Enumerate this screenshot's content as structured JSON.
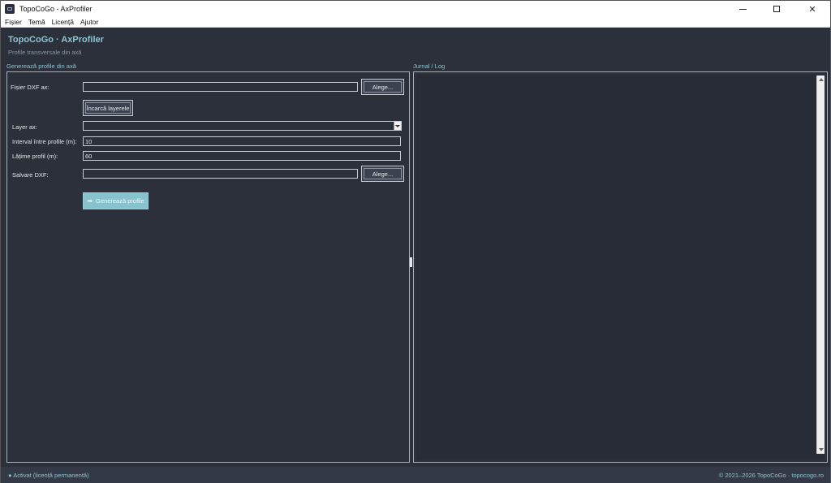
{
  "window": {
    "title": "TopoCoGo - AxProfiler",
    "app_icon": "app-icon"
  },
  "menu": [
    "Fișier",
    "Temă",
    "Licență",
    "Ajutor"
  ],
  "header": {
    "title": "TopoCoGo · AxProfiler",
    "subtitle": "Profile transversale din axă"
  },
  "generate_panel": {
    "title": "Generează profile din axă",
    "dxf_label": "Fișier DXF ax:",
    "dxf_value": "",
    "browse_label": "Alege...",
    "load_layers_label": "Încarcă layerele",
    "layer_label": "Layer ax:",
    "layer_value": "",
    "interval_label": "Interval între profile (m):",
    "interval_value": "10",
    "width_label": "Lățime profil (m):",
    "width_value": "60",
    "save_label": "Salvare DXF:",
    "save_value": "",
    "save_browse_label": "Alege...",
    "generate_label": "Generează profile",
    "generate_icon": "arrow-right-icon"
  },
  "log_panel": {
    "title": "Jurnal / Log"
  },
  "statusbar": {
    "license": "● Activat (licență permanentă)",
    "copyright": "© 2021–2026 TopoCoGo · topocogo.ro"
  },
  "colors": {
    "background": "#2b303b",
    "accent": "#8fc4d0",
    "primary_button": "#87c2cf"
  }
}
